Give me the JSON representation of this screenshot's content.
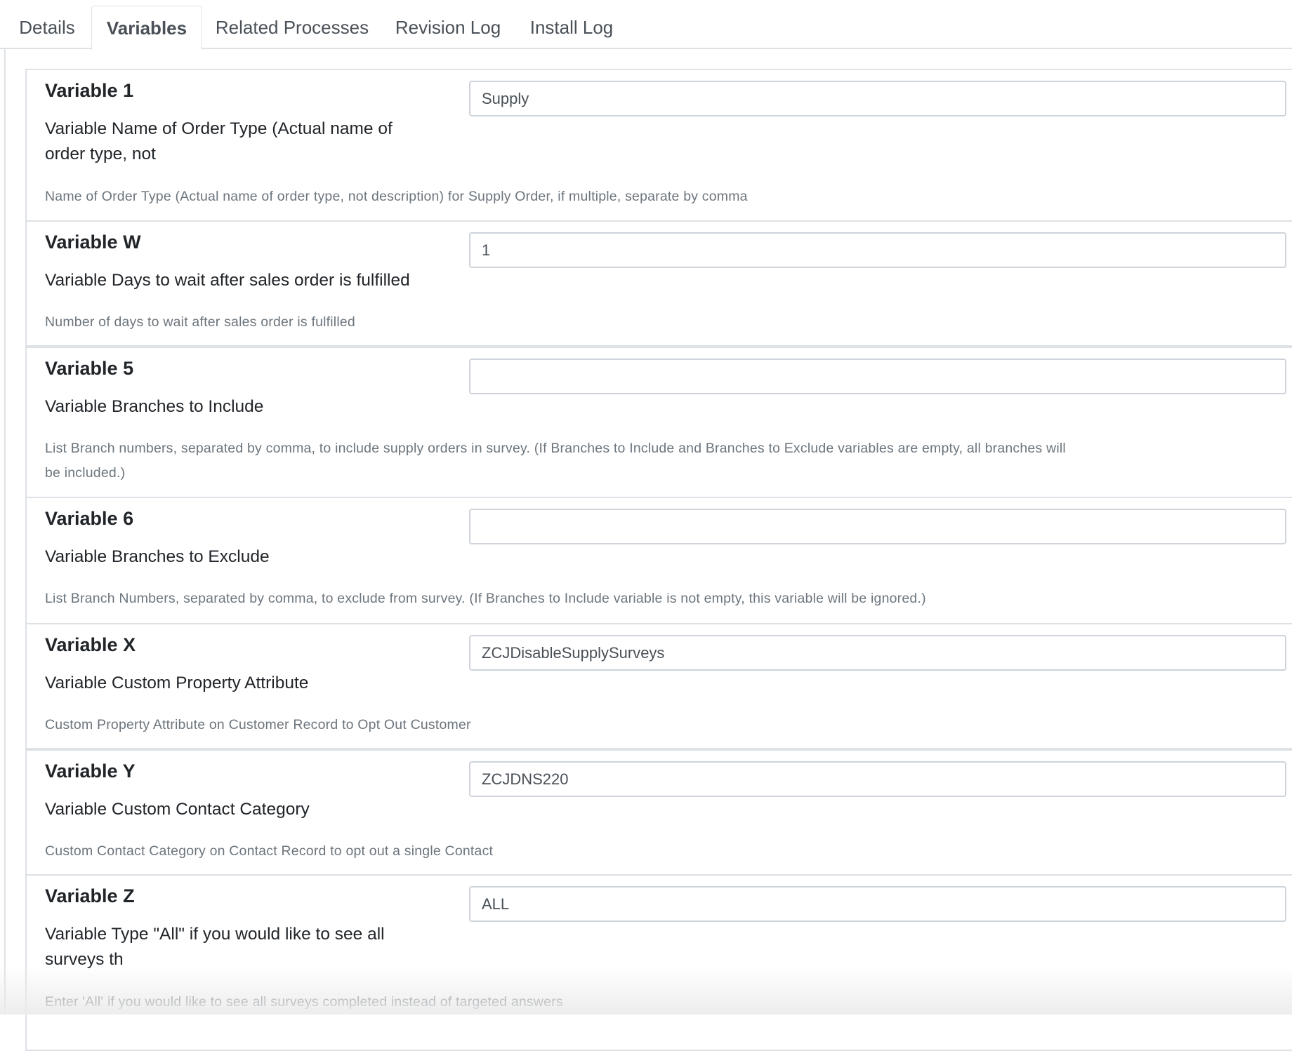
{
  "tabs": [
    {
      "label": "Details",
      "active": false
    },
    {
      "label": "Variables",
      "active": true
    },
    {
      "label": "Related Processes",
      "active": false
    },
    {
      "label": "Revision Log",
      "active": false
    },
    {
      "label": "Install Log",
      "active": false
    }
  ],
  "variables": [
    {
      "title": "Variable 1",
      "label": "Variable Name of Order Type (Actual name of order type, not",
      "value": "Supply",
      "help": "Name of Order Type (Actual name of order type, not description) for Supply Order, if multiple, separate by comma"
    },
    {
      "title": "Variable W",
      "label": "Variable Days to wait after sales order is fulfilled",
      "value": "1",
      "help": "Number of days to wait after sales order is fulfilled"
    },
    {
      "title": "Variable 5",
      "label": "Variable Branches to Include",
      "value": "",
      "help": "List Branch numbers, separated by comma, to include supply orders in survey.  (If Branches to Include and Branches to Exclude variables are empty, all branches will be included.)"
    },
    {
      "title": "Variable 6",
      "label": "Variable Branches to Exclude",
      "value": "",
      "help": "List Branch Numbers, separated by comma, to exclude from survey.  (If Branches to Include variable is not empty, this variable will be ignored.)"
    },
    {
      "title": "Variable X",
      "label": "Variable Custom Property Attribute",
      "value": "ZCJDisableSupplySurveys",
      "help": "Custom Property Attribute on Customer Record to Opt Out Customer"
    },
    {
      "title": "Variable Y",
      "label": "Variable Custom Contact Category",
      "value": "ZCJDNS220",
      "help": "Custom Contact Category on Contact Record to opt out a single Contact"
    },
    {
      "title": "Variable Z",
      "label": "Variable Type \"All\" if you would like to see all surveys th",
      "value": "ALL",
      "help": "Enter 'All' if you would like to see all surveys completed instead of targeted answers"
    }
  ]
}
